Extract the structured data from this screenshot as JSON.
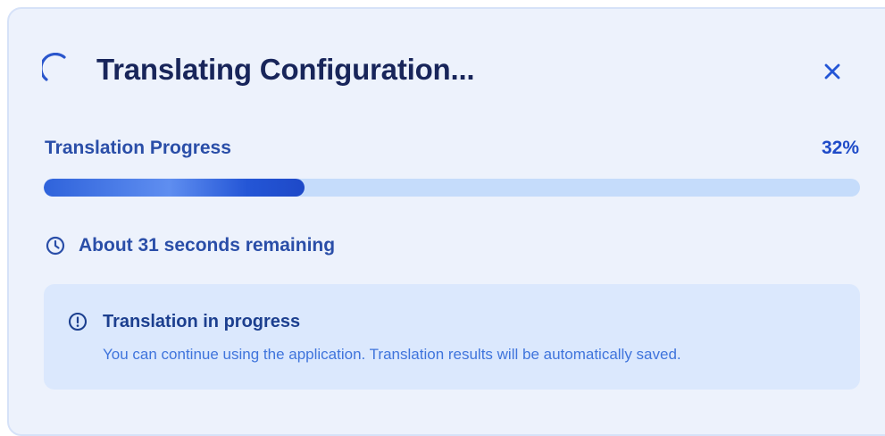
{
  "dialog": {
    "title": "Translating Configuration...",
    "close_icon": "close-icon",
    "spinner_icon": "loading-spinner-icon"
  },
  "progress": {
    "label": "Translation Progress",
    "percent_text": "32%",
    "value": 0.32
  },
  "status": {
    "icon": "clock-icon",
    "remaining_text": "About 31 seconds remaining"
  },
  "notice": {
    "icon": "info-circle-icon",
    "title": "Translation in progress",
    "message": "You can continue using the application. Translation results will be automatically saved."
  },
  "colors": {
    "card_background": "#edf2fc",
    "title": "#18255a",
    "accent": "#1f4bc8",
    "progress_track": "#c5dcfb",
    "notice_background": "#dbe8fd"
  }
}
